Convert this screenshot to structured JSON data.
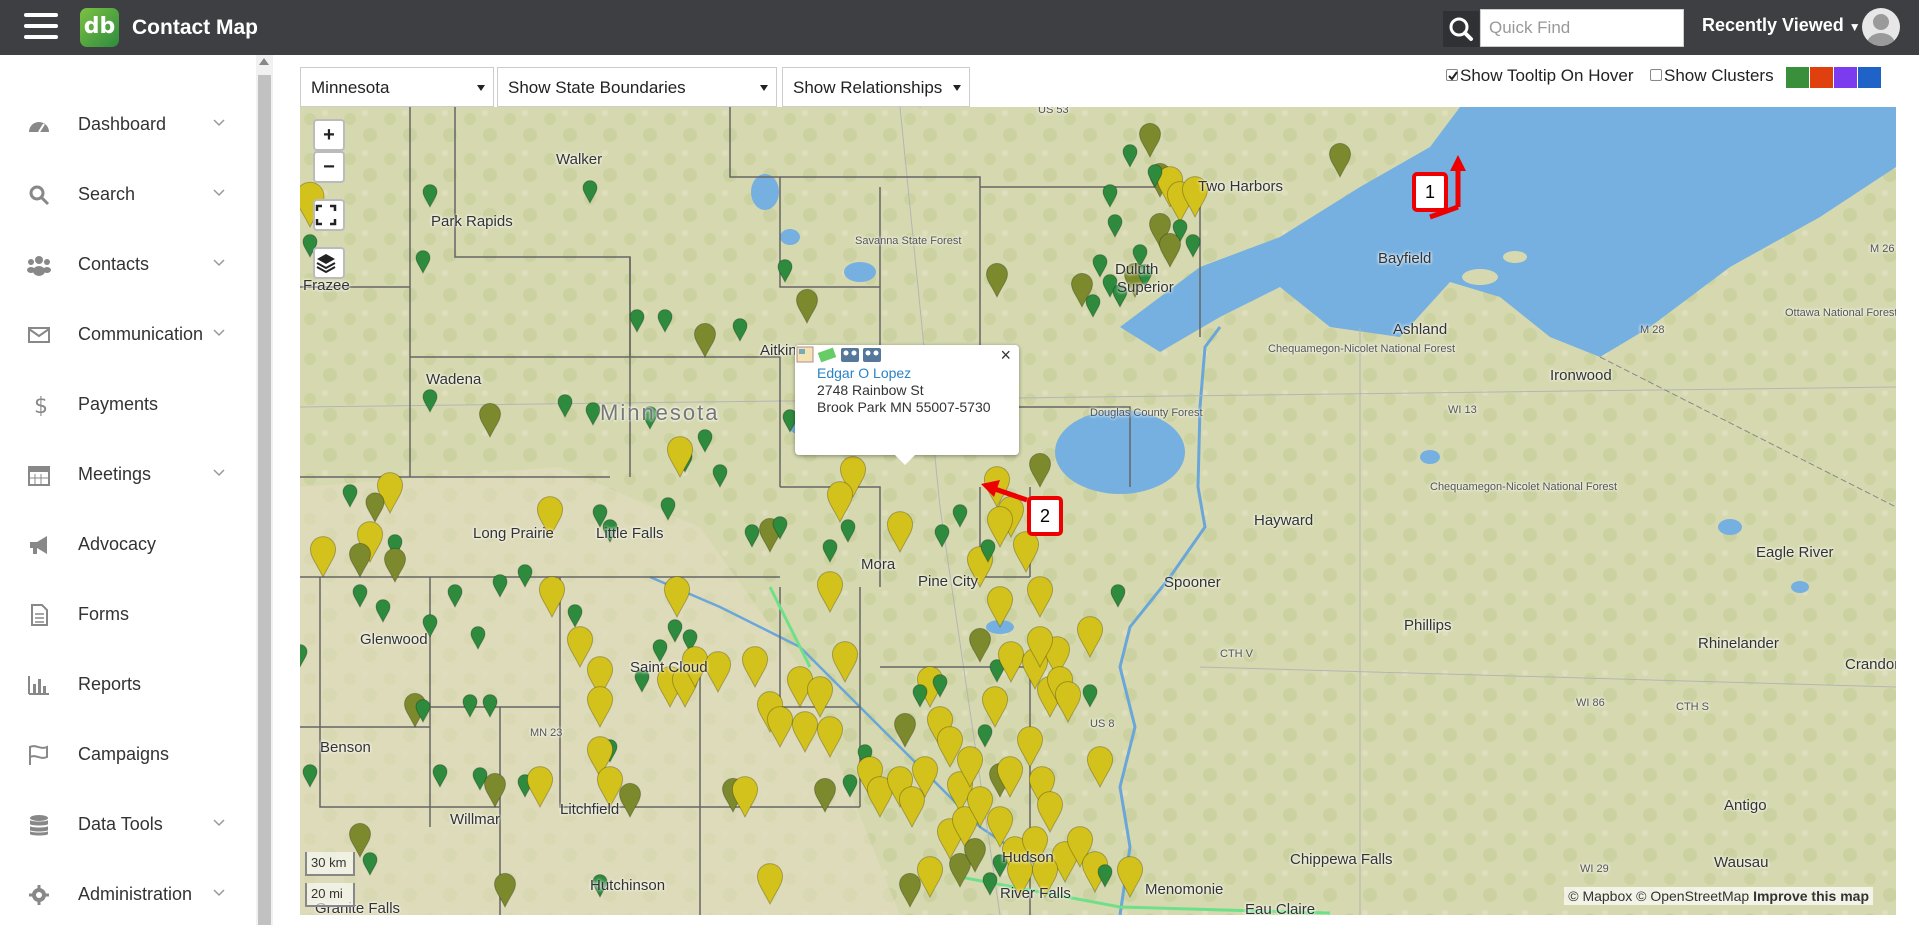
{
  "app": {
    "title": "Contact Map",
    "logo_text": "db"
  },
  "header": {
    "search_placeholder": "Quick Find",
    "recently_viewed": "Recently Viewed"
  },
  "sidebar": {
    "items": [
      {
        "label": "Dashboard",
        "icon": "dashboard-icon",
        "has_chevron": true
      },
      {
        "label": "Search",
        "icon": "search-icon",
        "has_chevron": true
      },
      {
        "label": "Contacts",
        "icon": "users-icon",
        "has_chevron": true
      },
      {
        "label": "Communication",
        "icon": "envelope-icon",
        "has_chevron": true
      },
      {
        "label": "Payments",
        "icon": "dollar-icon",
        "has_chevron": false
      },
      {
        "label": "Meetings",
        "icon": "calendar-icon",
        "has_chevron": true
      },
      {
        "label": "Advocacy",
        "icon": "megaphone-icon",
        "has_chevron": false
      },
      {
        "label": "Forms",
        "icon": "file-icon",
        "has_chevron": false
      },
      {
        "label": "Reports",
        "icon": "bar-chart-icon",
        "has_chevron": false
      },
      {
        "label": "Campaigns",
        "icon": "flag-icon",
        "has_chevron": false
      },
      {
        "label": "Data Tools",
        "icon": "database-icon",
        "has_chevron": true
      },
      {
        "label": "Administration",
        "icon": "gear-icon",
        "has_chevron": true
      }
    ]
  },
  "toolbar": {
    "state_select": "Minnesota",
    "boundaries_select": "Show State Boundaries",
    "relationships_select": "Show Relationships",
    "tooltip_label": "Show Tooltip On Hover",
    "tooltip_checked": true,
    "clusters_label": "Show Clusters",
    "clusters_checked": false,
    "color_swatches": [
      "#3a8f3a",
      "#e0400d",
      "#7b3cf0",
      "#2063c8"
    ]
  },
  "map": {
    "zoom_in": "+",
    "zoom_out": "−",
    "scale_km": "30 km",
    "scale_mi": "20 mi",
    "attribution": "© Mapbox © OpenStreetMap",
    "improve_link": "Improve this map",
    "places": [
      "Walker",
      "Park Rapids",
      "Two Harbors",
      "Duluth",
      "Superior",
      "Bayfield",
      "Ashland",
      "Ironwood",
      "Wadena",
      "Aitkin",
      "Minnesota",
      "Long Prairie",
      "Little Falls",
      "Mora",
      "Pine City",
      "Hayward",
      "Eagle River",
      "Spooner",
      "Phillips",
      "Rhinelander",
      "Crandon",
      "Glenwood",
      "Saint Cloud",
      "Benson",
      "Willmar",
      "Litchfield",
      "Hutchinson",
      "Hudson",
      "Menomonie",
      "Chippewa Falls",
      "Eau Claire",
      "River Falls",
      "Antigo",
      "Wausau",
      "Granite Falls",
      "Frazee"
    ],
    "small_places": [
      "Savanna State Forest",
      "Chequamegon-Nicolet National Forest",
      "Douglas County Forest",
      "Ottawa National Forest",
      "Chequamegon-Nicolet National Forest"
    ],
    "road_labels": [
      "US 53",
      "M 26",
      "M 28",
      "WI 13",
      "CTH V",
      "US 8",
      "MN 23",
      "WI 86",
      "CTH S",
      "WI 29"
    ]
  },
  "popup": {
    "name": "Edgar O Lopez",
    "address1": "2748 Rainbow St",
    "address2": "Brook Park MN 55007-5730",
    "close": "×"
  },
  "callouts": {
    "one": "1",
    "two": "2"
  }
}
